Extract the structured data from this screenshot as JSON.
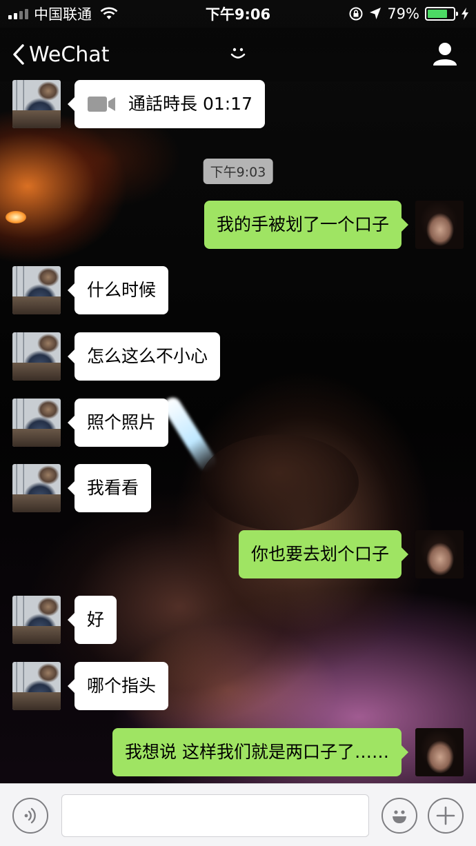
{
  "status_bar": {
    "carrier": "中国联通",
    "time": "下午9:06",
    "battery_percent": "79%",
    "battery_level": 0.79,
    "icons": [
      "signal-icon",
      "wifi-icon",
      "lock-rotation-icon",
      "location-icon",
      "battery-icon",
      "charging-icon"
    ]
  },
  "nav": {
    "back_label": "WeChat",
    "title_icon": "smiley-icon",
    "right_icon": "profile-icon"
  },
  "chat": {
    "call_record": {
      "text": "通話時長 01:17",
      "icon": "video-call-icon"
    },
    "timestamp": "下午9:03",
    "messages": [
      {
        "sender": "me",
        "text": "我的手被划了一个口子"
      },
      {
        "sender": "friend",
        "text": "什么时候"
      },
      {
        "sender": "friend",
        "text": "怎么这么不小心"
      },
      {
        "sender": "friend",
        "text": "照个照片"
      },
      {
        "sender": "friend",
        "text": "我看看"
      },
      {
        "sender": "me",
        "text": "你也要去划个口子"
      },
      {
        "sender": "friend",
        "text": "好"
      },
      {
        "sender": "friend",
        "text": "哪个指头"
      },
      {
        "sender": "me",
        "text": "我想说 这样我们就是两口子了……"
      }
    ]
  },
  "input_bar": {
    "value": "",
    "left_icon": "voice-icon",
    "emoji_icon": "emoji-icon",
    "plus_icon": "plus-icon"
  },
  "colors": {
    "outgoing_bubble": "#9fe463",
    "incoming_bubble": "#ffffff",
    "battery": "#4cd964"
  }
}
